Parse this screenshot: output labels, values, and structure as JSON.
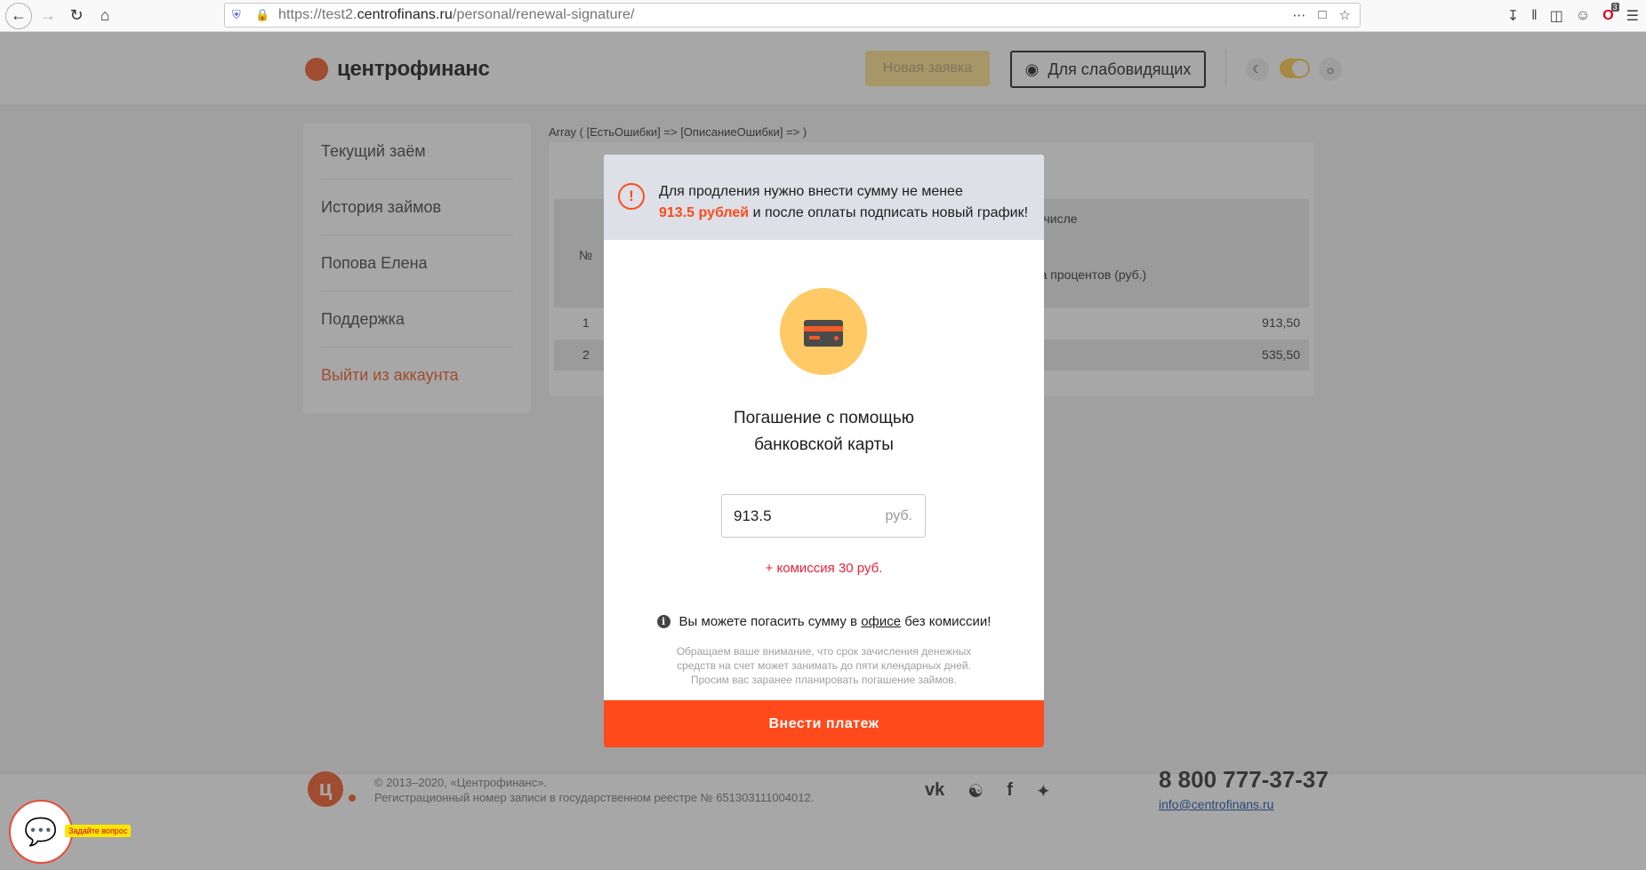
{
  "browser": {
    "url_prefix": "https://test2.",
    "url_domain": "centrofinans.ru",
    "url_path": "/personal/renewal-signature/",
    "notification_count": "3"
  },
  "header": {
    "logo_text": "центрофинанс",
    "new_request_label": "Новая заявка",
    "weak_vision_label": "Для слабовидящих"
  },
  "sidebar": {
    "items": [
      {
        "label": "Текущий заём"
      },
      {
        "label": "История займов"
      },
      {
        "label": "Попова Елена"
      },
      {
        "label": "Поддержка"
      },
      {
        "label": "Выйти из аккаунта"
      }
    ]
  },
  "content": {
    "debug_text": "Array ( [ЕстьОшибки] => [ОписаниеОшибки] => )",
    "table": {
      "col_no": "№",
      "col_including": "м числе",
      "col_percent_sum": "ма процентов (руб.)",
      "rows": [
        {
          "n": "1",
          "value": "913,50"
        },
        {
          "n": "2",
          "value": "535,50"
        }
      ]
    }
  },
  "modal": {
    "alert_line1": "Для продления нужно внести сумму не менее",
    "alert_amount": "913.5 рублей",
    "alert_line2": " и после оплаты подписать новый график!",
    "title_line1": "Погашение с помощью",
    "title_line2": "банковской карты",
    "amount_value": "913.5",
    "currency": "руб.",
    "commission": "+ комиссия 30 руб.",
    "info_before": "Вы можете погасить сумму в ",
    "info_link": "офисе",
    "info_after": " без комиссии!",
    "note_line1": "Обращаем ваше внимание, что срок зачисления денежных",
    "note_line2": "средств на счет может занимать до пяти клендарных дней.",
    "note_line3": "Просим вас заранее планировать погашение займов.",
    "pay_button": "Внести платеж"
  },
  "footer": {
    "logo_letter": "ц",
    "copyright": "© 2013–2020, «Центрофинанс».",
    "registry": "Регистрационный номер записи в государственном реестре № 651303111004012.",
    "phone": "8 800 777-37-37",
    "email": "info@centrofinans.ru",
    "chat_label": "Задайте вопрос"
  },
  "colors": {
    "accent": "#ff4a1c",
    "brand": "#f05a28",
    "card_circle": "#ffc965",
    "commission": "#e8233b"
  }
}
